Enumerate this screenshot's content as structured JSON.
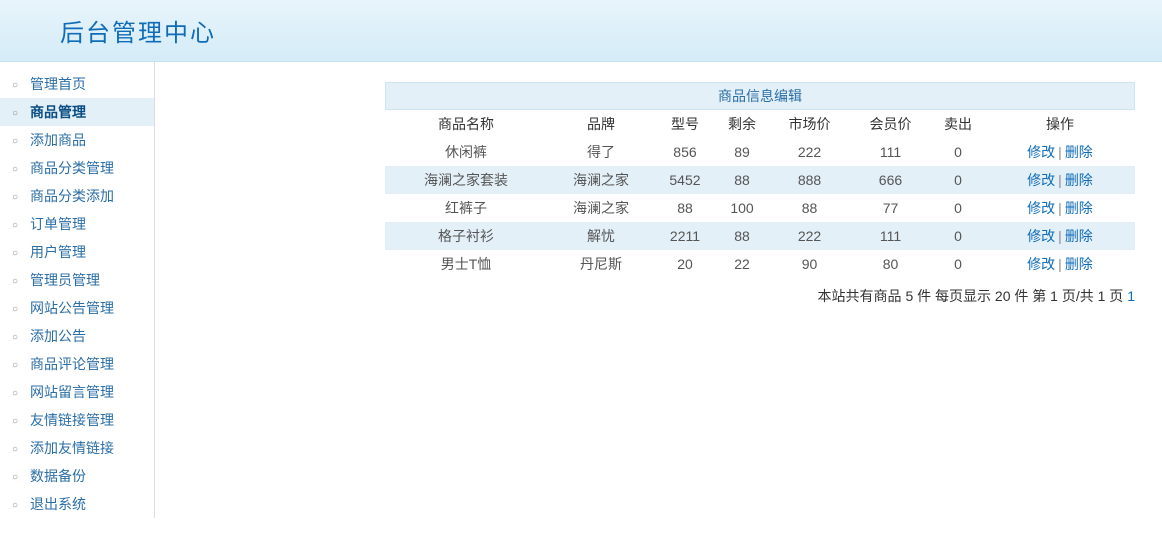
{
  "header": {
    "title": "后台管理中心"
  },
  "sidebar": {
    "items": [
      {
        "label": "管理首页",
        "active": false
      },
      {
        "label": "商品管理",
        "active": true
      },
      {
        "label": "添加商品",
        "active": false
      },
      {
        "label": "商品分类管理",
        "active": false
      },
      {
        "label": "商品分类添加",
        "active": false
      },
      {
        "label": "订单管理",
        "active": false
      },
      {
        "label": "用户管理",
        "active": false
      },
      {
        "label": "管理员管理",
        "active": false
      },
      {
        "label": "网站公告管理",
        "active": false
      },
      {
        "label": "添加公告",
        "active": false
      },
      {
        "label": "商品评论管理",
        "active": false
      },
      {
        "label": "网站留言管理",
        "active": false
      },
      {
        "label": "友情链接管理",
        "active": false
      },
      {
        "label": "添加友情链接",
        "active": false
      },
      {
        "label": "数据备份",
        "active": false
      },
      {
        "label": "退出系统",
        "active": false
      }
    ]
  },
  "table": {
    "title": "商品信息编辑",
    "headers": [
      "商品名称",
      "品牌",
      "型号",
      "剩余",
      "市场价",
      "会员价",
      "卖出",
      "操作"
    ],
    "rows": [
      {
        "name": "休闲裤",
        "brand": "得了",
        "model": "856",
        "stock": "89",
        "market": "222",
        "member": "111",
        "sold": "0"
      },
      {
        "name": "海澜之家套装",
        "brand": "海澜之家",
        "model": "5452",
        "stock": "88",
        "market": "888",
        "member": "666",
        "sold": "0"
      },
      {
        "name": "红裤子",
        "brand": "海澜之家",
        "model": "88",
        "stock": "100",
        "market": "88",
        "member": "77",
        "sold": "0"
      },
      {
        "name": "格子衬衫",
        "brand": "解忧",
        "model": "2211",
        "stock": "88",
        "market": "222",
        "member": "111",
        "sold": "0"
      },
      {
        "name": "男士T恤",
        "brand": "丹尼斯",
        "model": "20",
        "stock": "22",
        "market": "90",
        "member": "80",
        "sold": "0"
      }
    ],
    "ops": {
      "edit": "修改",
      "delete": "删除"
    }
  },
  "pager": {
    "prefix": "本站共有商品 ",
    "total": "5",
    "mid1": "  件 每页显示 ",
    "perpage": "20",
    "mid2": " 件 第 ",
    "curpage": "1",
    "mid3": " 页/共 ",
    "totalpage": "1",
    "mid4": " 页 ",
    "pagelink": "1"
  }
}
